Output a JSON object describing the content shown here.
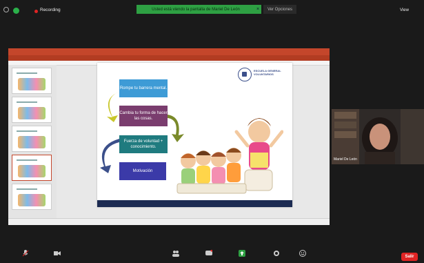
{
  "meeting": {
    "recording_label": "Recording",
    "share_banner": "Usted está viendo la pantalla de Mariel De León",
    "banner_close": "×",
    "view_options": "Ver Opciones",
    "view_button": "View",
    "leave_label": "Salir"
  },
  "participant": {
    "name": "Mariel De León"
  },
  "slide": {
    "steps": [
      "Rompe tu barrera mental.",
      "Cambia tu forma de hacer las cosas.",
      "Fuerza de voluntad + conocimiento.",
      "Motivación"
    ],
    "logo_title": "ESCUELA GENERAL VOLUNTARIOS",
    "colors": {
      "step1": "#3e9bd6",
      "step2": "#7a3d6e",
      "step3": "#1f7b7f",
      "step4": "#3b3aa8",
      "footer": "#1c2b52",
      "ppt_accent": "#c4462b",
      "leave": "#e02424",
      "share_banner": "#2ea043"
    }
  },
  "toolbar": {
    "items": [
      "mute-icon",
      "video-icon",
      "participants-icon",
      "chat-icon",
      "share-screen-icon",
      "record-icon",
      "reactions-icon"
    ]
  }
}
